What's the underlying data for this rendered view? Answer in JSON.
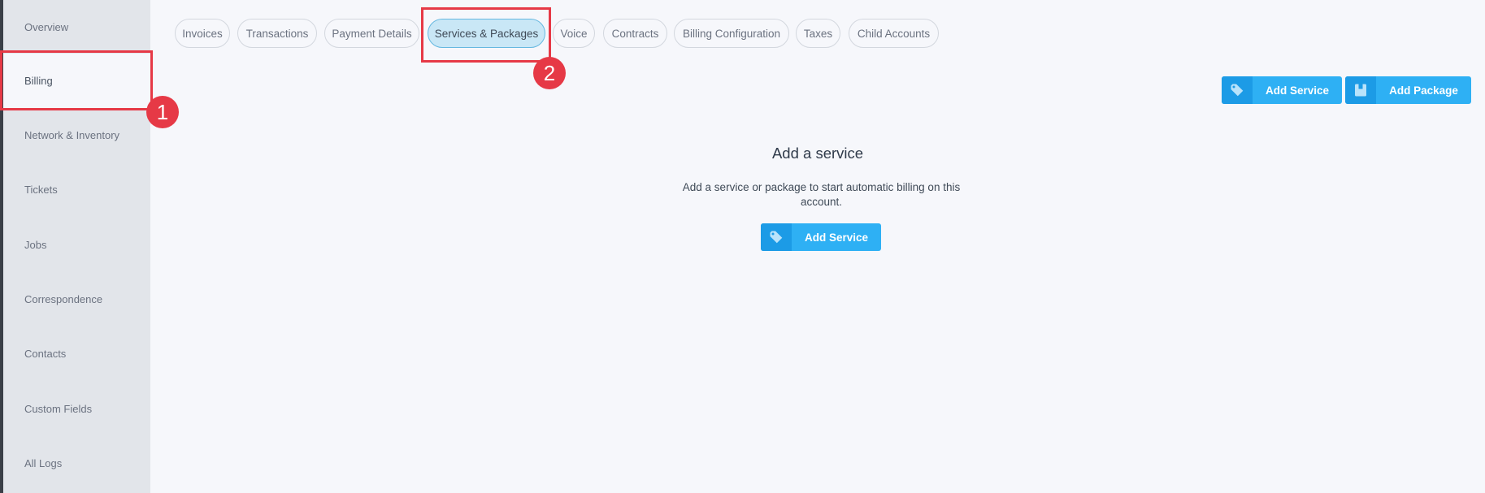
{
  "sidebar": {
    "items": [
      {
        "label": "Overview"
      },
      {
        "label": "Billing"
      },
      {
        "label": "Network & Inventory"
      },
      {
        "label": "Tickets"
      },
      {
        "label": "Jobs"
      },
      {
        "label": "Correspondence"
      },
      {
        "label": "Contacts"
      },
      {
        "label": "Custom Fields"
      },
      {
        "label": "All Logs"
      }
    ],
    "active": "Billing"
  },
  "tabs": [
    {
      "label": "Invoices"
    },
    {
      "label": "Transactions"
    },
    {
      "label": "Payment Details"
    },
    {
      "label": "Services & Packages"
    },
    {
      "label": "Voice"
    },
    {
      "label": "Contracts"
    },
    {
      "label": "Billing Configuration"
    },
    {
      "label": "Taxes"
    },
    {
      "label": "Child Accounts"
    }
  ],
  "active_tab": "Services & Packages",
  "toolbar": {
    "add_service_label": "Add Service",
    "add_package_label": "Add Package"
  },
  "empty_state": {
    "title": "Add a service",
    "description": "Add a service or package to start automatic billing on this account.",
    "button_label": "Add Service"
  },
  "annotations": {
    "badge_1": "1",
    "badge_2": "2"
  },
  "colors": {
    "accent": "#2eb0f4",
    "annotation": "#e63946",
    "active_tab_bg": "#c9e7f6"
  }
}
